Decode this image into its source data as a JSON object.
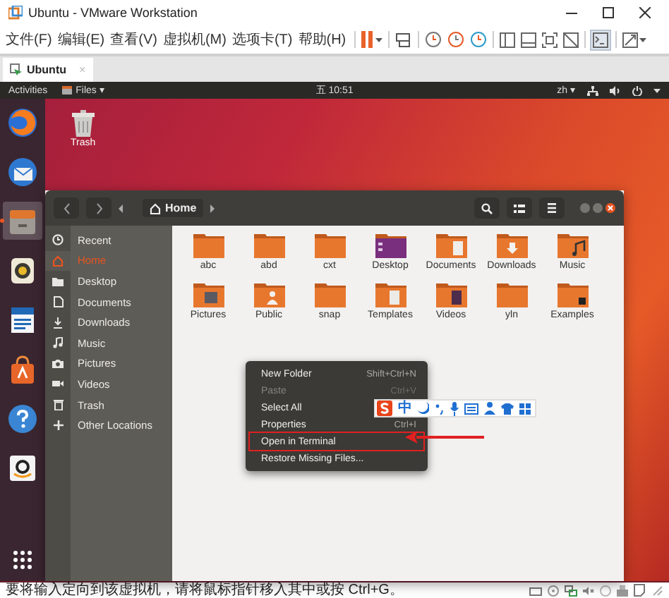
{
  "window": {
    "title": "Ubuntu - VMware Workstation"
  },
  "menu": [
    "文件(F)",
    "编辑(E)",
    "查看(V)",
    "虚拟机(M)",
    "选项卡(T)",
    "帮助(H)"
  ],
  "tabs": [
    {
      "label": "Ubuntu",
      "selected": true,
      "close": "×"
    }
  ],
  "top_bar": {
    "activities": "Activities",
    "app_menu": "Files ▾",
    "clock": "五 10:51",
    "input_method": "zh ▾"
  },
  "launcher": [
    {
      "kind": "browser",
      "selected": false
    },
    {
      "kind": "mail",
      "selected": false
    },
    {
      "kind": "files",
      "selected": true
    },
    {
      "kind": "music",
      "selected": false
    },
    {
      "kind": "writer",
      "selected": false
    },
    {
      "kind": "store",
      "selected": false
    },
    {
      "kind": "help",
      "selected": false
    },
    {
      "kind": "shop",
      "selected": false
    }
  ],
  "desktop_icons": [
    {
      "label": "Trash"
    }
  ],
  "files": {
    "path": "Home",
    "sidebar": [
      {
        "label": "Recent",
        "kind": "recent",
        "selected": false
      },
      {
        "label": "Home",
        "kind": "home",
        "selected": true
      },
      {
        "label": "Desktop",
        "kind": "folder",
        "selected": false
      },
      {
        "label": "Documents",
        "kind": "document",
        "selected": false
      },
      {
        "label": "Downloads",
        "kind": "download",
        "selected": false
      },
      {
        "label": "Music",
        "kind": "music",
        "selected": false
      },
      {
        "label": "Pictures",
        "kind": "camera",
        "selected": false
      },
      {
        "label": "Videos",
        "kind": "video",
        "selected": false
      },
      {
        "label": "Trash",
        "kind": "trash",
        "selected": false
      },
      {
        "label": "Other Locations",
        "kind": "plus",
        "selected": false
      }
    ],
    "items": [
      {
        "label": "abc",
        "kind": "plain"
      },
      {
        "label": "abd",
        "kind": "plain"
      },
      {
        "label": "cxt",
        "kind": "plain"
      },
      {
        "label": "Desktop",
        "kind": "desktop"
      },
      {
        "label": "Documents",
        "kind": "documents"
      },
      {
        "label": "Downloads",
        "kind": "downloads"
      },
      {
        "label": "Music",
        "kind": "music"
      },
      {
        "label": "Pictures",
        "kind": "pictures"
      },
      {
        "label": "Public",
        "kind": "public"
      },
      {
        "label": "snap",
        "kind": "plain"
      },
      {
        "label": "Templates",
        "kind": "templates"
      },
      {
        "label": "Videos",
        "kind": "videos"
      },
      {
        "label": "yln",
        "kind": "plain"
      },
      {
        "label": "Examples",
        "kind": "link"
      }
    ]
  },
  "context_menu": [
    {
      "label": "New Folder",
      "shortcut": "Shift+Ctrl+N",
      "disabled": false,
      "highlighted": false
    },
    {
      "label": "Paste",
      "shortcut": "Ctrl+V",
      "disabled": true,
      "highlighted": false
    },
    {
      "label": "Select All",
      "disabled": false,
      "highlighted": false
    },
    {
      "label": "Properties",
      "shortcut": "Ctrl+I",
      "disabled": false,
      "highlighted": false
    },
    {
      "label": "Open in Terminal",
      "disabled": false,
      "highlighted": true
    },
    {
      "label": "Restore Missing Files...",
      "disabled": false,
      "highlighted": false
    }
  ],
  "ime_bar": {
    "mode": "中"
  },
  "status_bar": {
    "message": "要将输入定向到该虚拟机，请将鼠标指针移入其中或按 Ctrl+G。"
  }
}
